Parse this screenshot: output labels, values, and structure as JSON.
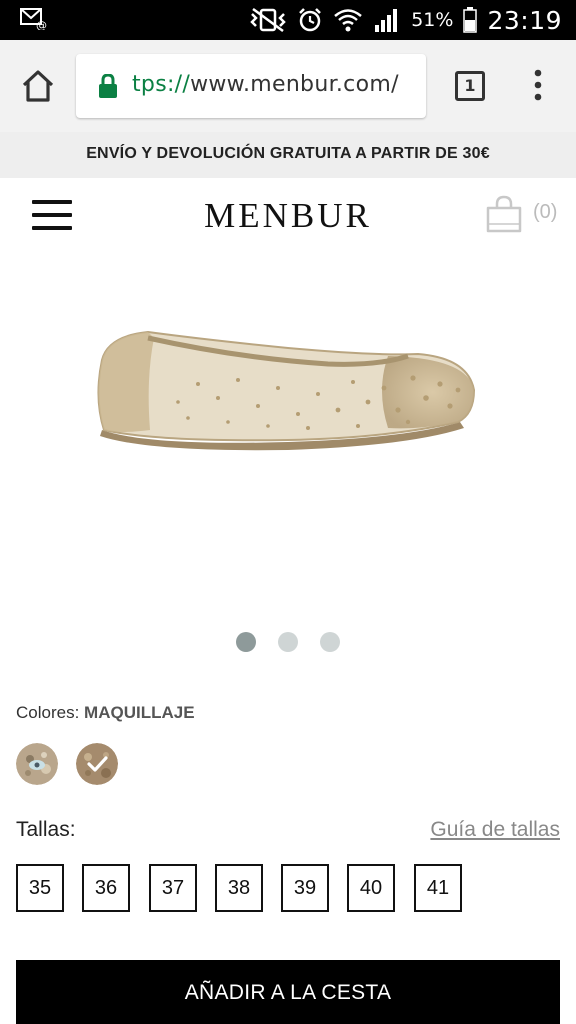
{
  "status_bar": {
    "battery_pct": "51%",
    "time": "23:19",
    "icons": [
      "notification-icon",
      "vibrate-icon",
      "alarm-icon",
      "wifi-icon",
      "signal-icon",
      "battery-icon"
    ]
  },
  "browser": {
    "url_scheme": "tps://",
    "url_rest": "www.menbur.com/",
    "tab_count": "1",
    "icons": [
      "home-icon",
      "lock-icon",
      "overflow-menu-icon"
    ]
  },
  "promo": {
    "text": "ENVÍO Y DEVOLUCIÓN GRATUITA A PARTIR DE 30€"
  },
  "header": {
    "logo": "MENBUR",
    "cart_count": "(0)",
    "icons": [
      "hamburger-menu-icon",
      "shopping-bag-icon"
    ]
  },
  "product": {
    "image_pages": 3,
    "active_page": 1,
    "colors_label": "Colores:",
    "color_name": "MAQUILLAJE",
    "swatches": [
      {
        "name": "swatch-1",
        "color": "#b9a68c",
        "selected": false
      },
      {
        "name": "swatch-2",
        "color": "#a58b6d",
        "selected": true
      }
    ],
    "sizes_label": "Tallas:",
    "size_guide": "Guía de tallas",
    "sizes": [
      "35",
      "36",
      "37",
      "38",
      "39",
      "40",
      "41"
    ],
    "add_to_cart": "AÑADIR A LA CESTA"
  },
  "colors": {
    "status_bar_bg": "#000000",
    "toolbar_bg": "#f2f2f2",
    "secure_green": "#0b8043",
    "promo_bg": "#eeeeee",
    "dot_active": "#8e9a9a",
    "dot_inactive": "#cfd5d5",
    "button_bg": "#000000"
  }
}
